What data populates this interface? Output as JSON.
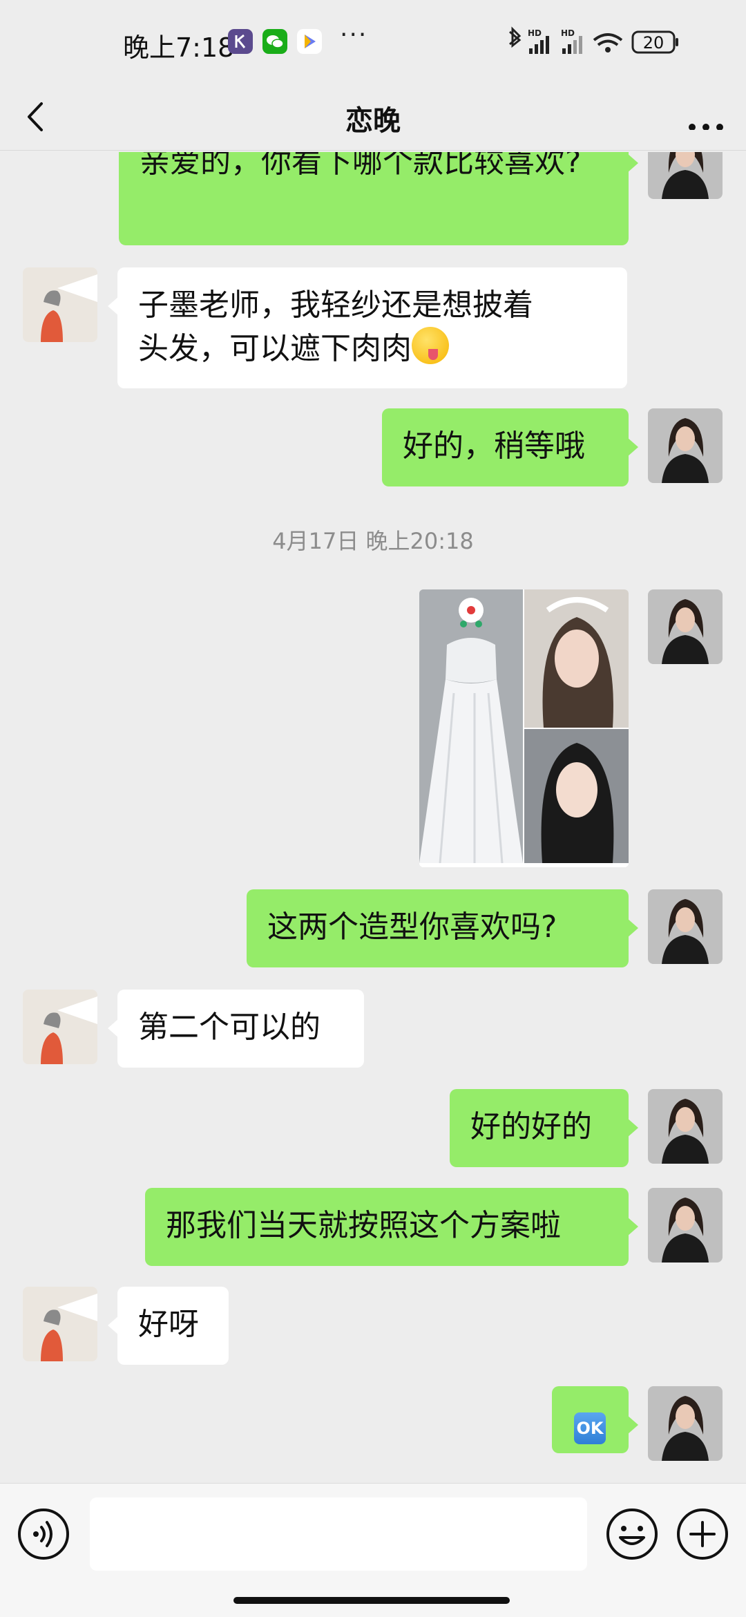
{
  "status_bar": {
    "time": "晚上7:18",
    "more": "···",
    "battery": "20"
  },
  "header": {
    "title": "恋晚"
  },
  "messages": [
    {
      "side": "sent",
      "text": "亲爱的，你看下哪个款比较喜欢?"
    },
    {
      "side": "recv",
      "text_line1": "子墨老师，我轻纱还是想披着",
      "text_line2": "头发，可以遮下肉肉"
    },
    {
      "side": "sent",
      "text": "好的，稍等哦"
    },
    {
      "timestamp": "4月17日 晚上20:18"
    },
    {
      "side": "sent",
      "text": "这两个造型你喜欢吗?"
    },
    {
      "side": "recv",
      "text": "第二个可以的"
    },
    {
      "side": "sent",
      "text": "好的好的"
    },
    {
      "side": "sent",
      "text": "那我们当天就按照这个方案啦"
    },
    {
      "side": "recv",
      "text": "好呀"
    },
    {
      "side": "sent",
      "text": "OK"
    }
  ],
  "icons": {
    "back": "chevron-left-icon",
    "more": "more-dots-icon",
    "voice": "voice-icon",
    "emoji": "smiley-icon",
    "plus": "plus-icon"
  },
  "colors": {
    "sent_bubble": "#95ec69",
    "recv_bubble": "#ffffff",
    "background": "#ededed"
  }
}
